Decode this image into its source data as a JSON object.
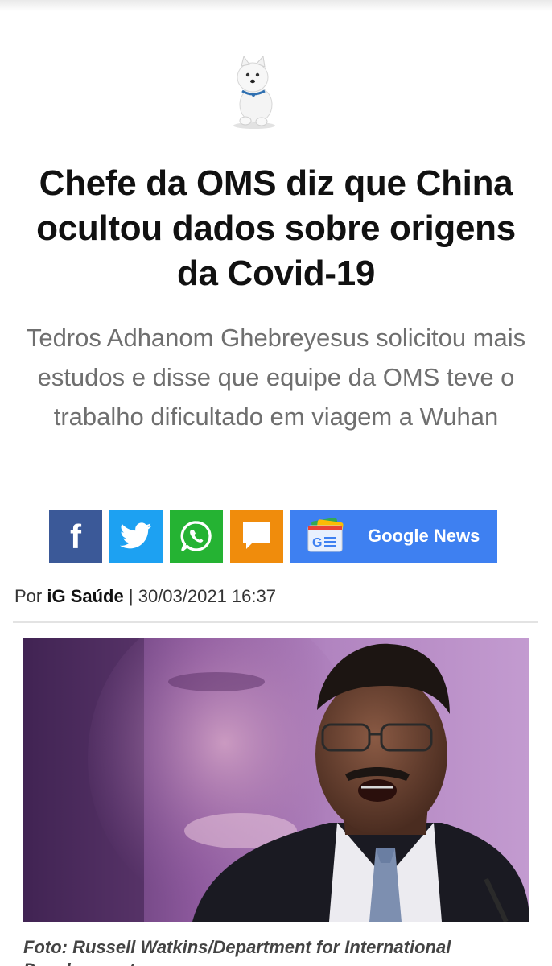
{
  "header": {
    "logo_icon": "westie-dog-mascot-icon"
  },
  "article": {
    "headline": "Chefe da OMS diz que China ocultou dados sobre origens da Covid-19",
    "subtitle": "Tedros Adhanom Ghebreyesus solicitou mais estudos e disse que equipe da OMS teve o trabalho dificultado em viagem a Wuhan",
    "byline": {
      "prefix": "Por",
      "author": "iG Saúde",
      "separator": "|",
      "datetime": "30/03/2021 16:37"
    },
    "photo_icon": "speaker-at-podium-photo",
    "caption": "Foto: Russell Watkins/Department for International Development"
  },
  "share": {
    "facebook_icon": "facebook-icon",
    "twitter_icon": "twitter-icon",
    "whatsapp_icon": "whatsapp-icon",
    "comment_icon": "comment-icon",
    "google_news_icon": "google-news-icon",
    "google_news_label": "Google News"
  },
  "colors": {
    "facebook": "#3b5998",
    "twitter": "#1da1f2",
    "whatsapp": "#25b333",
    "comment": "#f08c0c",
    "google_news": "#3e80f1",
    "headline": "#111111",
    "subtitle": "#6f6f6f"
  }
}
